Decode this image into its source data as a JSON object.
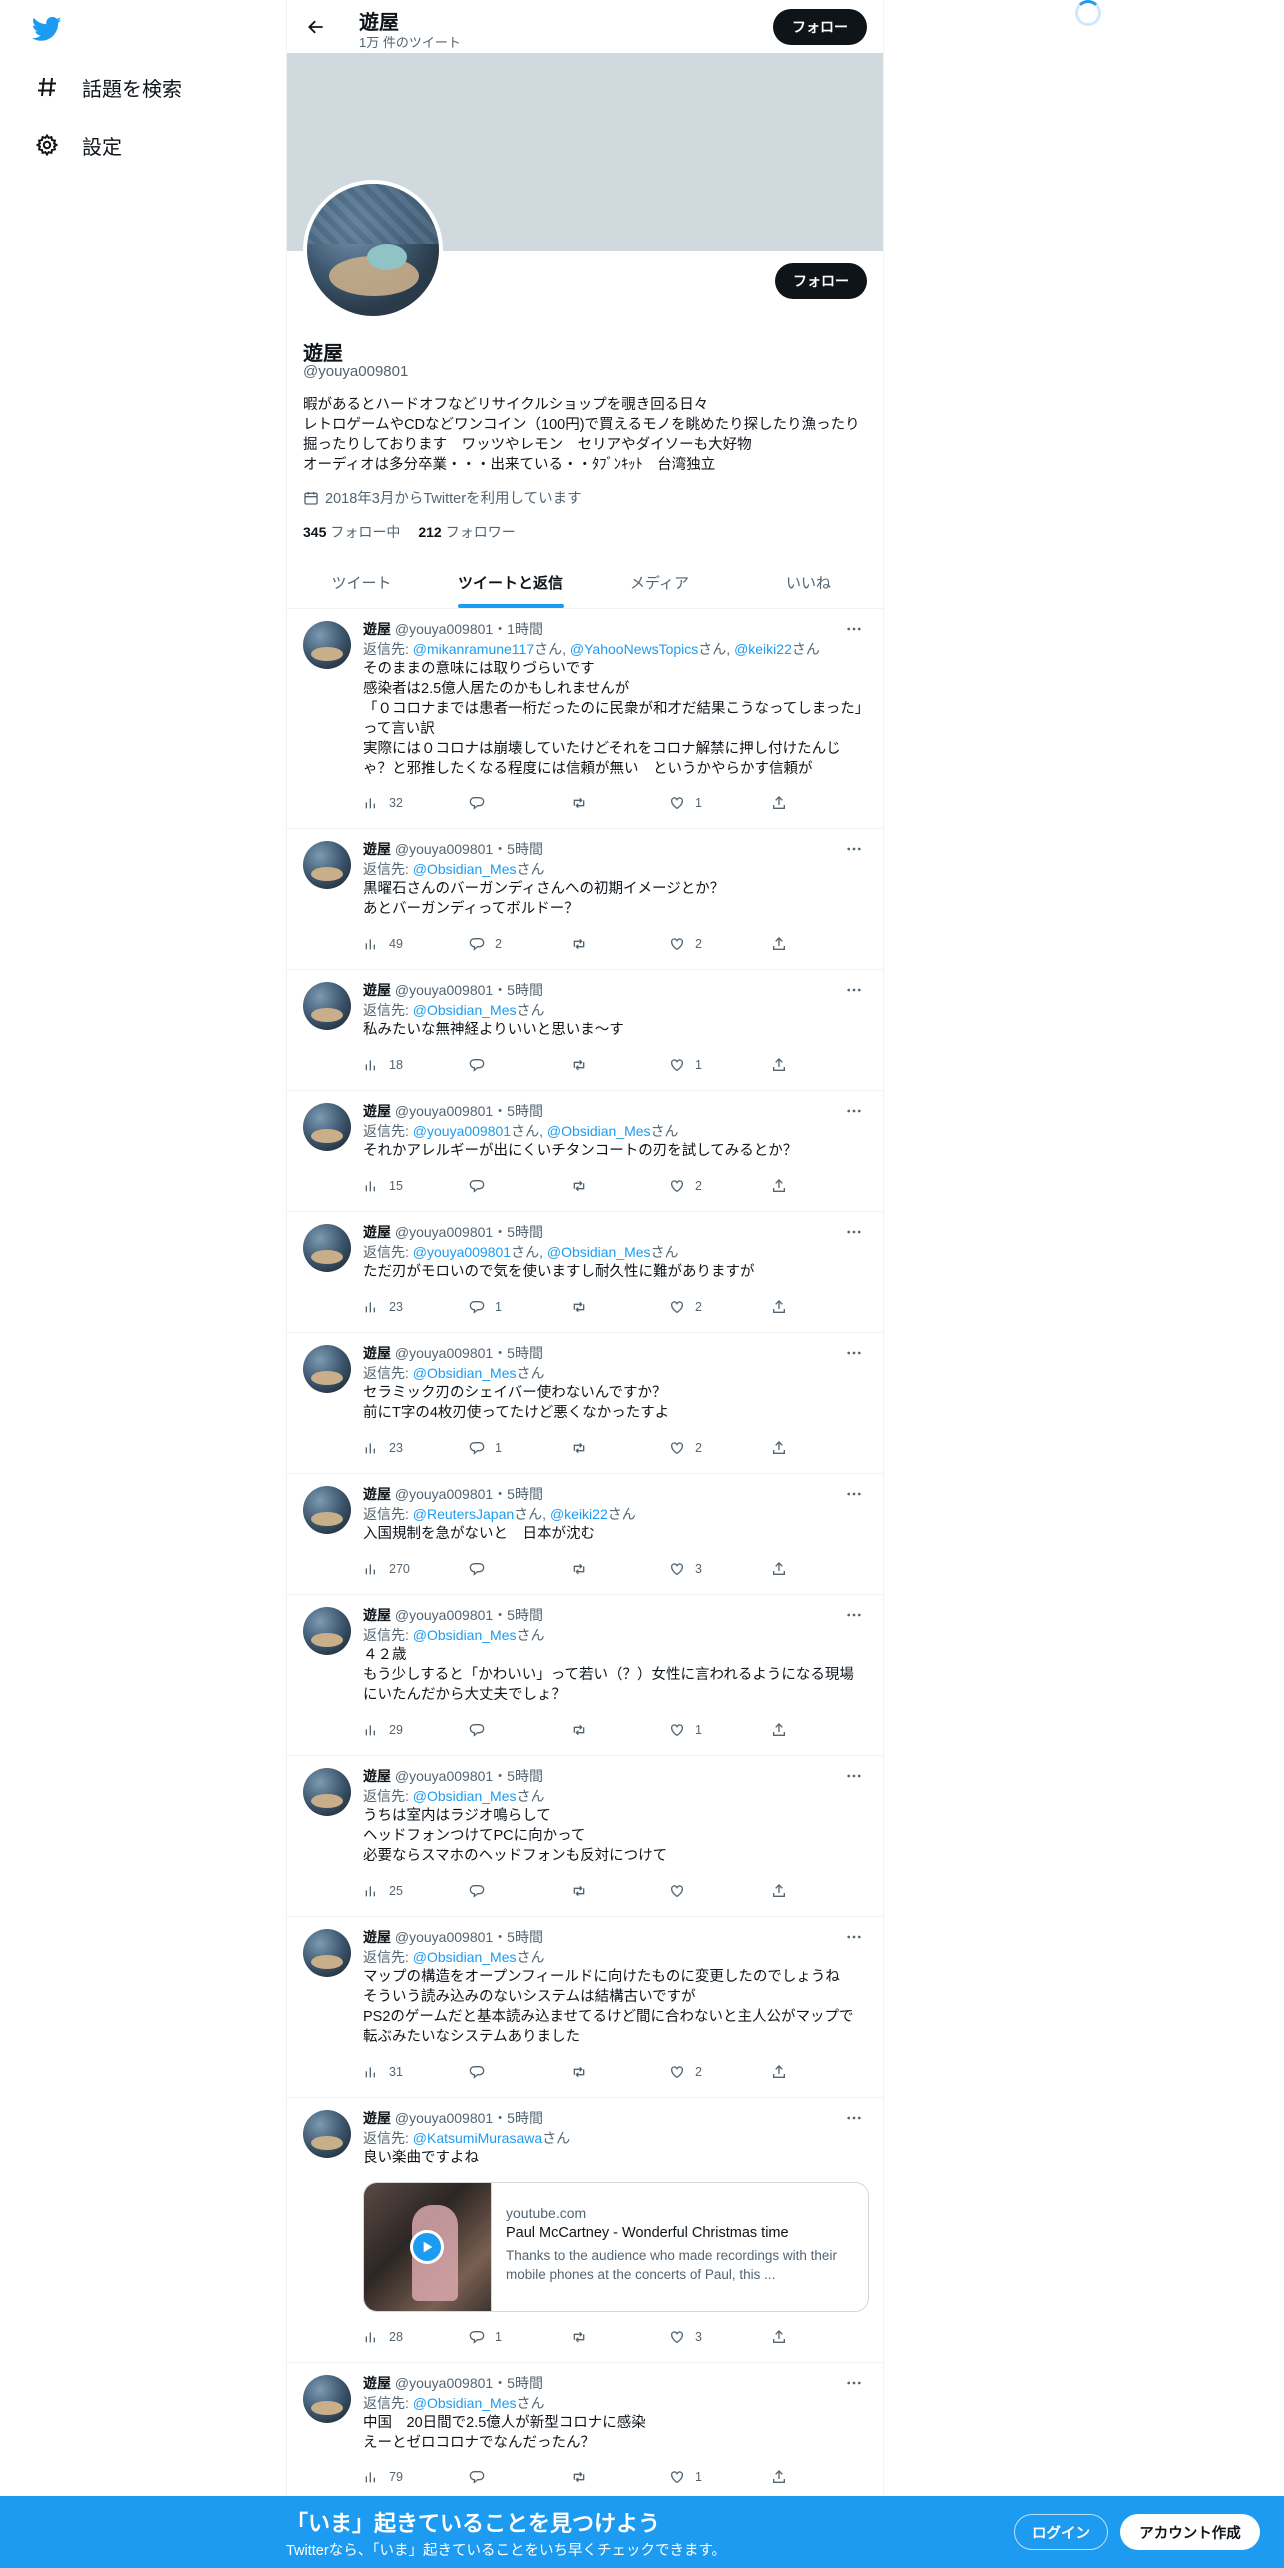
{
  "nav": {
    "items": [
      {
        "label": "話題を検索",
        "icon": "hashtag-icon"
      },
      {
        "label": "設定",
        "icon": "gear-icon"
      }
    ]
  },
  "header": {
    "name": "遊屋",
    "tweet_count": "1万 件のツイート",
    "follow_label": "フォロー"
  },
  "profile": {
    "name": "遊屋",
    "handle": "@youya009801",
    "follow_label": "フォロー",
    "bio": [
      "暇があるとハードオフなどリサイクルショップを覗き回る日々",
      "レトロゲームやCDなどワンコイン（100円)で買えるモノを眺めたり探したり漁ったり掘ったりしております　ワッツやレモン　セリアやダイソーも大好物",
      "オーディオは多分卒業・・・出来ている・・ﾀﾌﾞﾝｷｯﾄ　台湾独立"
    ],
    "joined": "2018年3月からTwitterを利用しています",
    "following_count": "345",
    "following_label": "フォロー中",
    "followers_count": "212",
    "followers_label": "フォロワー"
  },
  "tabs": [
    {
      "label": "ツイート",
      "active": false
    },
    {
      "label": "ツイートと返信",
      "active": true
    },
    {
      "label": "メディア",
      "active": false
    },
    {
      "label": "いいね",
      "active": false
    }
  ],
  "tweets": [
    {
      "name": "遊屋",
      "handle": "@youya009801",
      "time": "1時間",
      "reply_prefix": "返信先: ",
      "mentions": [
        "@mikanramune117",
        "@YahooNewsTopics",
        "@keiki22"
      ],
      "text": [
        "そのままの意味には取りづらいです",
        "感染者は2.5億人居たのかもしれませんが",
        "「０コロナまでは患者一桁だったのに民衆が和才だ結果こうなってしまった」って言い訳",
        "実際には０コロナは崩壊していたけどそれをコロナ解禁に押し付けたんじゃ？と邪推したくなる程度には信頼が無い　というかやらかす信頼が"
      ],
      "views": "32",
      "replies": "",
      "retweets": "",
      "likes": "1"
    },
    {
      "name": "遊屋",
      "handle": "@youya009801",
      "time": "5時間",
      "reply_prefix": "返信先: ",
      "mentions": [
        "@Obsidian_Mes"
      ],
      "text": [
        "黒曜石さんのバーガンディさんへの初期イメージとか？",
        "あとバーガンディってボルドー？"
      ],
      "views": "49",
      "replies": "2",
      "retweets": "",
      "likes": "2"
    },
    {
      "name": "遊屋",
      "handle": "@youya009801",
      "time": "5時間",
      "reply_prefix": "返信先: ",
      "mentions": [
        "@Obsidian_Mes"
      ],
      "text": [
        "私みたいな無神経よりいいと思いま～す"
      ],
      "views": "18",
      "replies": "",
      "retweets": "",
      "likes": "1"
    },
    {
      "name": "遊屋",
      "handle": "@youya009801",
      "time": "5時間",
      "reply_prefix": "返信先: ",
      "mentions": [
        "@youya009801",
        "@Obsidian_Mes"
      ],
      "text": [
        "それかアレルギーが出にくいチタンコートの刃を試してみるとか？"
      ],
      "views": "15",
      "replies": "",
      "retweets": "",
      "likes": "2"
    },
    {
      "name": "遊屋",
      "handle": "@youya009801",
      "time": "5時間",
      "reply_prefix": "返信先: ",
      "mentions": [
        "@youya009801",
        "@Obsidian_Mes"
      ],
      "text": [
        "ただ刃がモロいので気を使いますし耐久性に難がありますが"
      ],
      "views": "23",
      "replies": "1",
      "retweets": "",
      "likes": "2"
    },
    {
      "name": "遊屋",
      "handle": "@youya009801",
      "time": "5時間",
      "reply_prefix": "返信先: ",
      "mentions": [
        "@Obsidian_Mes"
      ],
      "text": [
        "セラミック刃のシェイバー使わないんですか？",
        "前にT字の4枚刃使ってたけど悪くなかったすよ"
      ],
      "views": "23",
      "replies": "1",
      "retweets": "",
      "likes": "2"
    },
    {
      "name": "遊屋",
      "handle": "@youya009801",
      "time": "5時間",
      "reply_prefix": "返信先: ",
      "mentions": [
        "@ReutersJapan",
        "@keiki22"
      ],
      "text": [
        "入国規制を急がないと　日本が沈む"
      ],
      "views": "270",
      "replies": "",
      "retweets": "",
      "likes": "3"
    },
    {
      "name": "遊屋",
      "handle": "@youya009801",
      "time": "5時間",
      "reply_prefix": "返信先: ",
      "mentions": [
        "@Obsidian_Mes"
      ],
      "text": [
        "４２歳",
        "もう少しすると「かわいい」って若い（？）女性に言われるようになる現場にいたんだから大丈夫でしょ？"
      ],
      "views": "29",
      "replies": "",
      "retweets": "",
      "likes": "1"
    },
    {
      "name": "遊屋",
      "handle": "@youya009801",
      "time": "5時間",
      "reply_prefix": "返信先: ",
      "mentions": [
        "@Obsidian_Mes"
      ],
      "text": [
        "うちは室内はラジオ鳴らして",
        "ヘッドフォンつけてPCに向かって",
        "必要ならスマホのヘッドフォンも反対につけて"
      ],
      "views": "25",
      "replies": "",
      "retweets": "",
      "likes": ""
    },
    {
      "name": "遊屋",
      "handle": "@youya009801",
      "time": "5時間",
      "reply_prefix": "返信先: ",
      "mentions": [
        "@Obsidian_Mes"
      ],
      "text": [
        "マップの構造をオープンフィールドに向けたものに変更したのでしょうね",
        "そういう読み込みのないシステムは結構古いですが",
        "PS2のゲームだと基本読み込ませてるけど間に合わないと主人公がマップで転ぶみたいなシステムありました"
      ],
      "views": "31",
      "replies": "",
      "retweets": "",
      "likes": "2"
    },
    {
      "name": "遊屋",
      "handle": "@youya009801",
      "time": "5時間",
      "reply_prefix": "返信先: ",
      "mentions": [
        "@KatsumiMurasawa"
      ],
      "text": [
        "良い楽曲ですよね"
      ],
      "card": {
        "domain": "youtube.com",
        "title": "Paul McCartney - Wonderful Christmas time",
        "desc": "Thanks to the audience who made recordings with their mobile phones at the concerts of Paul, this ..."
      },
      "views": "28",
      "replies": "1",
      "retweets": "",
      "likes": "3"
    },
    {
      "name": "遊屋",
      "handle": "@youya009801",
      "time": "5時間",
      "reply_prefix": "返信先: ",
      "mentions": [
        "@Obsidian_Mes"
      ],
      "text": [
        "中国　20日間で2.5億人が新型コロナに感染",
        "えーとゼロコロナでなんだったん？"
      ],
      "views": "79",
      "replies": "",
      "retweets": "",
      "likes": "1"
    }
  ],
  "mention_suffix": "さん",
  "bottom_bar": {
    "title": "「いま」起きていることを見つけよう",
    "subtitle": "Twitterなら、「いま」起きていることをいち早くチェックできます。",
    "login": "ログイン",
    "signup": "アカウント作成"
  },
  "colors": {
    "accent": "#1d9bf0",
    "text": "#0f1419",
    "muted": "#536471",
    "banner": "#cfd9de"
  }
}
